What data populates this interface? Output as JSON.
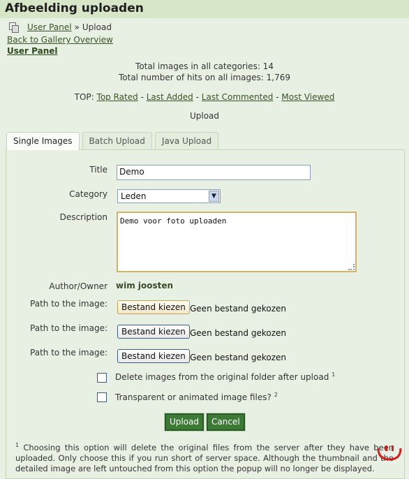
{
  "page": {
    "title": "Afbeelding uploaden"
  },
  "breadcrumb": {
    "link": "User Panel",
    "separator": "»",
    "current": "Upload"
  },
  "nav": {
    "back": "Back to Gallery Overview",
    "user_panel": "User Panel"
  },
  "stats": {
    "total_images": "Total images in all categories: 14",
    "total_hits": "Total number of hits on all images: 1,769"
  },
  "top": {
    "prefix": "TOP:",
    "links": [
      "Top Rated",
      "Last Added",
      "Last Commented",
      "Most Viewed"
    ],
    "separator": "-"
  },
  "section_title": "Upload",
  "tabs": [
    {
      "label": "Single Images",
      "active": true
    },
    {
      "label": "Batch Upload",
      "active": false
    },
    {
      "label": "Java Upload",
      "active": false
    }
  ],
  "form": {
    "title_label": "Title",
    "title_value": "Demo",
    "category_label": "Category",
    "category_value": "Leden",
    "description_label": "Description",
    "description_value": "Demo voor foto uploaden",
    "author_label": "Author/Owner",
    "author_value": "wim joosten",
    "path_label": "Path to the image:",
    "file_button": "Bestand kiezen",
    "no_file": "Geen bestand gekozen",
    "delete_label": "Delete images from the original folder after upload",
    "delete_note": "1",
    "transparent_label": "Transparent or animated image files?",
    "transparent_note": "2",
    "upload_button": "Upload",
    "cancel_button": "Cancel"
  },
  "footnote": {
    "marker": "1",
    "text": "Choosing this option will delete the original files from the server after they have been uploaded. Only choose this if you run short of server space. Although the thumbnail and the detailed image are left untouched from this option the popup will no longer be displayed."
  },
  "colors": {
    "header": "#d6e6c6",
    "background": "#e8f0e3",
    "button": "#3c7a36",
    "corner_icon": "#d62020"
  }
}
